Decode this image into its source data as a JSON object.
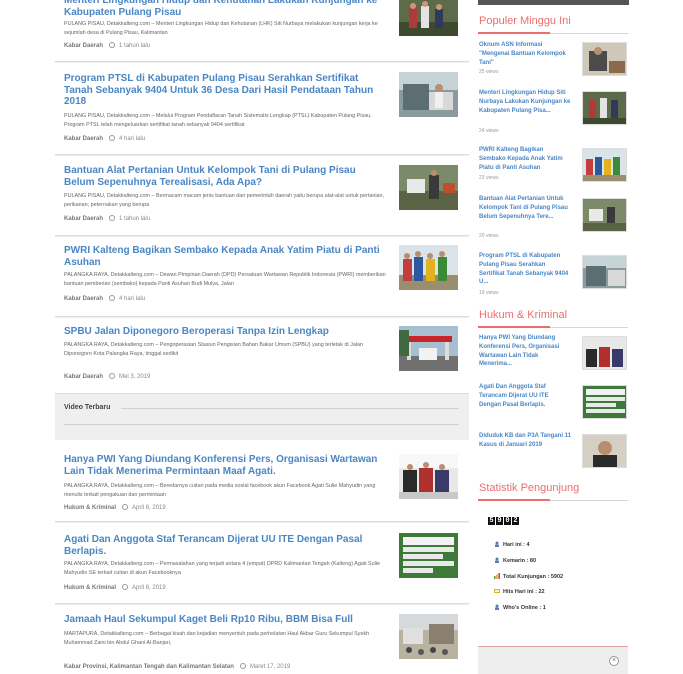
{
  "posts": [
    {
      "title": "Menteri Lingkungan Hidup dan Kehutanan Lakukan Kunjungan ke Kabupaten Pulang Pisau",
      "excerpt": "PULANG PISAU, Detakkalteng.com – Menteri Lingkungan Hidup dan Kehutanan (LHK) Siti Nurbaya melakukan kunjungan kerja ke sejumlah desa di Pulang Pisau, Kalimantan",
      "category": "Kabar Daerah",
      "date": "1 tahun lalu"
    },
    {
      "title": "Program PTSL di Kabupaten Pulang Pisau Serahkan Sertifikat Tanah Sebanyak 9404 Untuk 36 Desa Dari Hasil Pendataan Tahun 2018",
      "excerpt": "PULANG PISAU, Detakkalteng.com – Melalui Program Pendaftaran Tanah Sistematis Lengkap (PTSL) Kabupaten Pulang Pisau, Program PTSL telah mengeluarkan sertifikat tanah sebanyak 9404 sertifikat",
      "category": "Kabar Daerah",
      "date": "4 hari lalu"
    },
    {
      "title": "Bantuan Alat Pertanian Untuk Kelompok Tani di Pulang Pisau Belum Sepenuhnya Terealisasi, Ada Apa?",
      "excerpt": "PULANG PISAU, Detakkalteng.com – Bermacam macam jenis bantuan dari pemerintah daerah yaitu berupa alat-alat untuk pertanian, perikanan, peternakan yang berupa",
      "category": "Kabar Daerah",
      "date": "1 tahun lalu"
    },
    {
      "title": "PWRI Kalteng Bagikan Sembako Kepada Anak Yatim Piatu di Panti Asuhan",
      "excerpt": "PALANGKA RAYA, Detakkalteng.com – Dewan Pimpinan Daerah (DPD) Persatuan Wartawan Republik Indonesia (PWRI) memberikan bantuan pemberian (sembako) kepada Panti Asuhan Budi Mulya, Jalan",
      "category": "Kabar Daerah",
      "date": "4 hari lalu"
    },
    {
      "title": "SPBU Jalan Diponegoro Beroperasi Tanpa Izin Lengkap",
      "excerpt": "PALANGKA RAYA, Detakkalteng.com – Pengoperasian Stasiun Pengisian Bahan Bakar Umum (SPBU) yang terletak di Jalan Diponegoro Kota Palangka Raya, tinggal sedikit",
      "category": "Kabar Daerah",
      "date": "Mei 3, 2019"
    },
    {
      "title": "Hanya PWI Yang Diundang Konferensi Pers, Organisasi Wartawan Lain Tidak Menerima Permintaan Maaf Agati.",
      "excerpt": "PALANGKA RAYA, Detakkalteng.com – Beredarnya cuitan pada media sosial facebook akun Facebook Agati Sulie Mahyudin yang menulis terkait pengakuan dan permintaan",
      "category": "Hukum & Kriminal",
      "date": "April 8, 2019"
    },
    {
      "title": "Agati Dan Anggota Staf Terancam Dijerat UU ITE Dengan Pasal Berlapis.",
      "excerpt": "PALANGKA RAYA, Detakkalteng.com – Permasalahan yang terjadi antara 4 (empat) DPRD Kalimantan Tengah (Kalteng) Agati Sulie Mahyudin SE terkait cuitan di akun Facebooknya",
      "category": "Hukum & Kriminal",
      "date": "April 8, 2019"
    },
    {
      "title": "Jamaah Haul Sekumpul Kaget Beli Rp10 Ribu, BBM Bisa Full",
      "excerpt": "MARTAPURA, Detakkalteng.com – Berbagai kisah dan kejadian menyentuh pada perhelatan Haul Akbar Guru Sekumpul Syekh Muhammad Zaini bin Abdul Ghani Al-Banjari,",
      "category": "Kabar Provinsi, Kalimantan Tengah dan Kalimantan Selatan",
      "date": "Maret 17, 2019"
    }
  ],
  "video_section": {
    "heading": "Video Terbaru"
  },
  "sidebar": {
    "popular_heading": "Populer Minggu Ini",
    "popular": [
      {
        "title": "Oknum ASN Informasi \"Mengenai Bantuan Kelompok Tani\"",
        "views": "25 views"
      },
      {
        "title": "Menteri Lingkungan Hidup Siti Nurbaya Lakukan Kunjungan ke Kabupaten Pulang Pisa...",
        "views": "24 views"
      },
      {
        "title": "PWRI Kalteng Bagikan Sembako Kepada Anak Yatim Piatu di Panti Asuhan",
        "views": "23 views"
      },
      {
        "title": "Bantuan Alat Pertanian Untuk Kelompok Tani di Pulang Pisau Belum Sepenuhnya Tere...",
        "views": "20 views"
      },
      {
        "title": "Program PTSL di Kabupaten Pulang Pisau Serahkan Sertifikat Tanah Sebanyak 9404 U...",
        "views": "19 views"
      }
    ],
    "crime_heading": "Hukum & Kriminal",
    "crime": [
      {
        "title": "Hanya PWI Yang Diundang Konferensi Pers, Organisasi Wartawan Lain Tidak Menerima..."
      },
      {
        "title": "Agati Dan Anggota Staf Terancam Dijerat UU ITE Dengan Pasal Berlapis."
      },
      {
        "title": "Diduduk KB dan P3A Tangani 11 Kasus di Januari 2019"
      }
    ],
    "stats_heading": "Statistik Pengunjung",
    "counter": [
      "5",
      "9",
      "0",
      "2"
    ],
    "stats": {
      "today": "Hari ini : 4",
      "yesterday": "Kemarin : 80",
      "total": "Total Kunjungan : 5902",
      "hits": "Hits Hari ini : 22",
      "online": "Who's Online : 1"
    },
    "ad_close": "×"
  },
  "colors": {
    "link": "#4a86c5",
    "accent": "#ec6d6d",
    "panel": "#efefef"
  }
}
